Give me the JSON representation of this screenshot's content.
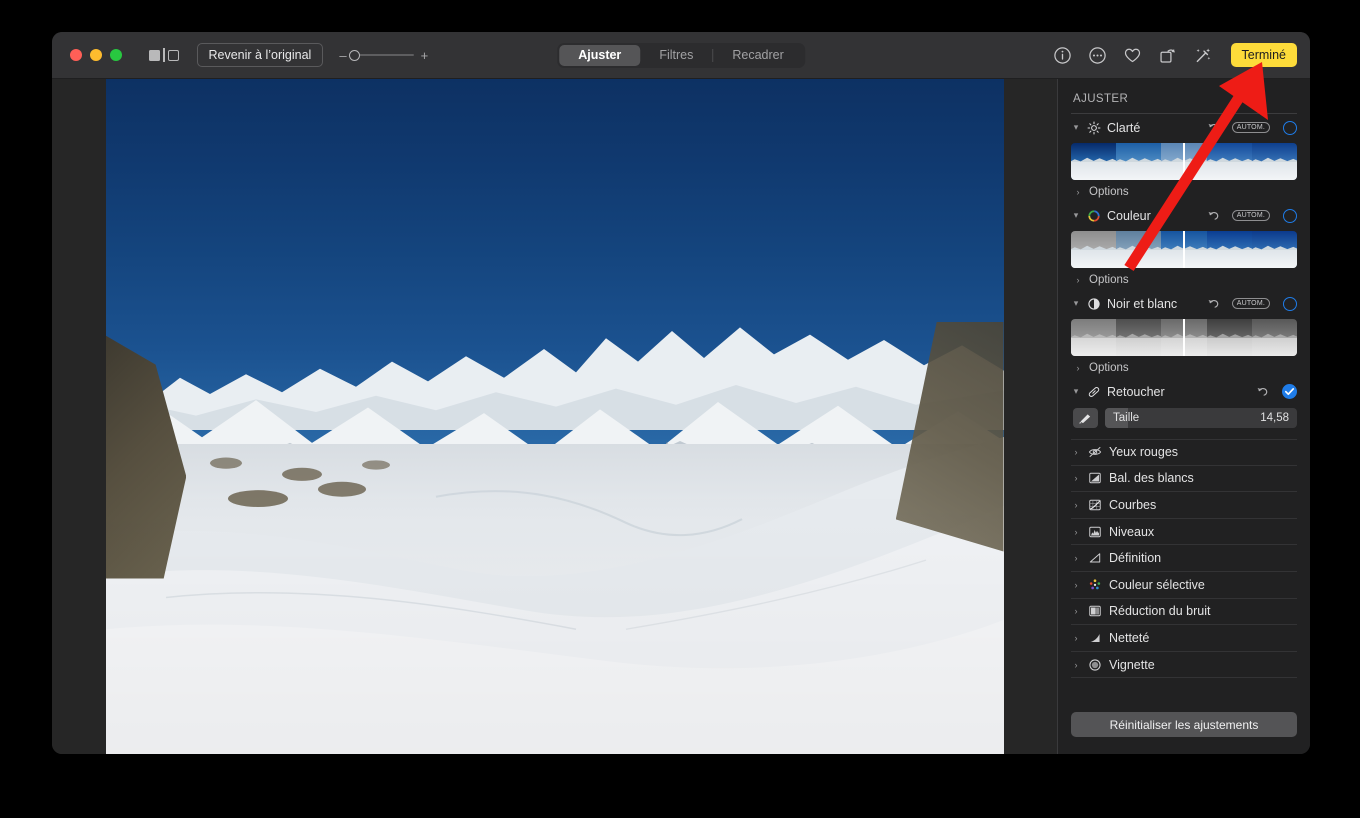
{
  "window": {
    "traffic_lights": [
      "close",
      "minimize",
      "zoom"
    ],
    "colors": {
      "close": "#ff5f57",
      "minimize": "#febc2e",
      "zoom": "#28c840",
      "accent_blue": "#1f7ce8",
      "done_yellow": "#fddb3a",
      "annotation_red": "#ee1c16",
      "titlebar_bg": "#333335",
      "sidebar_bg": "#212122",
      "canvas_bg": "#262626"
    }
  },
  "toolbar": {
    "compare_toggle": "compare-view-toggle",
    "revert_label": "Revenir à l’original",
    "zoom_minus": "–",
    "zoom_plus": "+",
    "zoom_value_percent": 0,
    "tabs": [
      {
        "label": "Ajuster",
        "active": true
      },
      {
        "label": "Filtres",
        "active": false
      },
      {
        "label": "Recadrer",
        "active": false
      }
    ],
    "right_icons": [
      "info-icon",
      "more-ellipsis-icon",
      "favorite-heart-icon",
      "rotate-icon",
      "auto-enhance-wand-icon"
    ],
    "done_label": "Terminé"
  },
  "sidebar": {
    "panel_title": "AJUSTER",
    "auto_badge": "AUTOM.",
    "options_label": "Options",
    "expanded": [
      {
        "label": "Clarté",
        "icon": "brightness-sun-icon",
        "expanded": true,
        "has_auto": true,
        "checked": false,
        "filmstrip": true,
        "marker_percent": 50,
        "has_options": true
      },
      {
        "label": "Couleur",
        "icon": "color-wheel-icon",
        "expanded": true,
        "has_auto": true,
        "checked": false,
        "filmstrip": true,
        "marker_percent": 50,
        "has_options": true
      },
      {
        "label": "Noir et blanc",
        "icon": "black-white-circle-icon",
        "expanded": true,
        "has_auto": true,
        "checked": false,
        "filmstrip": true,
        "marker_percent": 50,
        "has_options": true
      },
      {
        "label": "Retoucher",
        "icon": "retouch-bandage-icon",
        "expanded": true,
        "has_auto": false,
        "checked": true,
        "filmstrip": false,
        "has_options": false
      }
    ],
    "retouch_slider": {
      "brush_icon": "brush-icon",
      "label": "Taille",
      "value": "14,58",
      "fill_percent": 12
    },
    "collapsed": [
      {
        "label": "Yeux rouges",
        "icon": "red-eye-icon"
      },
      {
        "label": "Bal. des blancs",
        "icon": "white-balance-icon"
      },
      {
        "label": "Courbes",
        "icon": "curves-icon"
      },
      {
        "label": "Niveaux",
        "icon": "levels-icon"
      },
      {
        "label": "Définition",
        "icon": "definition-icon"
      },
      {
        "label": "Couleur sélective",
        "icon": "selective-color-icon"
      },
      {
        "label": "Réduction du bruit",
        "icon": "noise-reduction-icon"
      },
      {
        "label": "Netteté",
        "icon": "sharpness-icon"
      },
      {
        "label": "Vignette",
        "icon": "vignette-icon"
      }
    ],
    "reset_label": "Réinitialiser les ajustements"
  },
  "photo": {
    "description": "Panorama de montagne enneigée sous un ciel bleu"
  },
  "annotation": {
    "type": "arrow",
    "points_to": "Terminé",
    "color": "#ee1c16"
  }
}
